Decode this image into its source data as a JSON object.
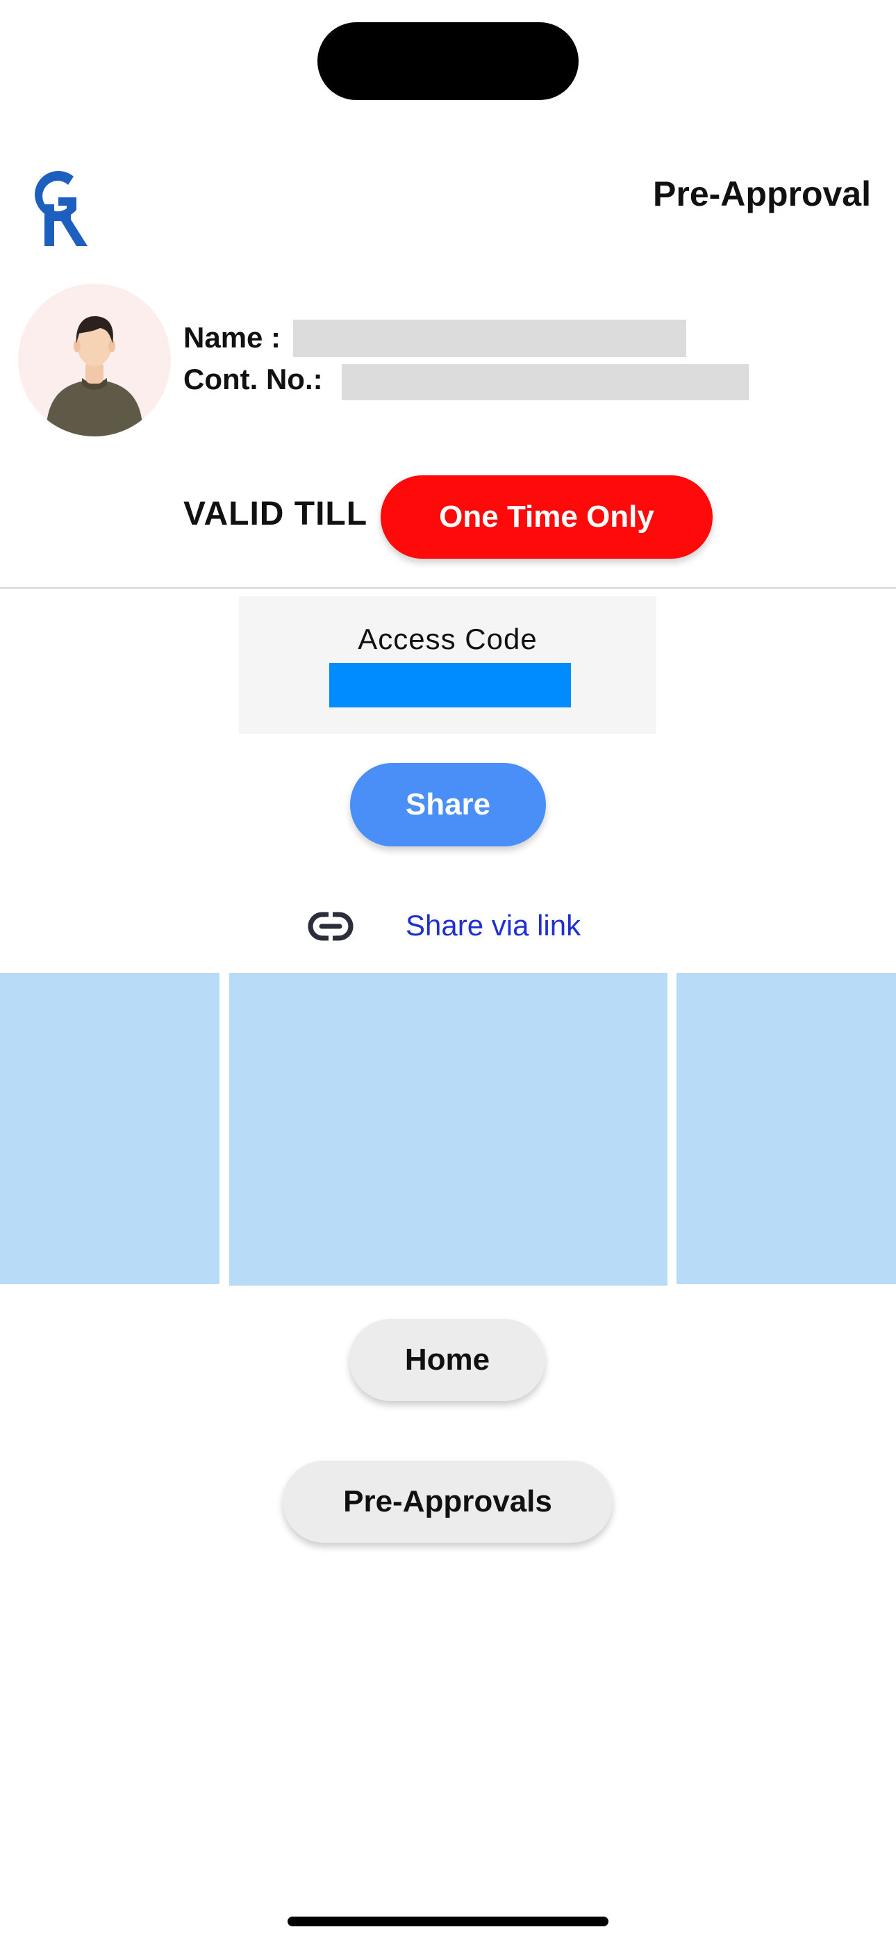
{
  "header": {
    "logo_text": "GR",
    "title": "Pre-Approval"
  },
  "profile": {
    "name_label": "Name :",
    "contact_label": "Cont. No.:"
  },
  "validity": {
    "label": "VALID TILL",
    "value": "One Time Only"
  },
  "access": {
    "label": "Access Code"
  },
  "actions": {
    "share_label": "Share",
    "share_link_label": "Share via link",
    "home_label": "Home",
    "pre_approvals_label": "Pre-Approvals"
  },
  "colors": {
    "brand_blue": "#1d5fbf",
    "validity_red": "#ff0a0a",
    "share_blue": "#4a8ef8",
    "access_code_blue": "#008cff",
    "link_blue": "#1f2fd0",
    "tile_blue": "#b8dcf8"
  },
  "icons": {
    "link": "link-icon",
    "avatar": "user-avatar"
  }
}
